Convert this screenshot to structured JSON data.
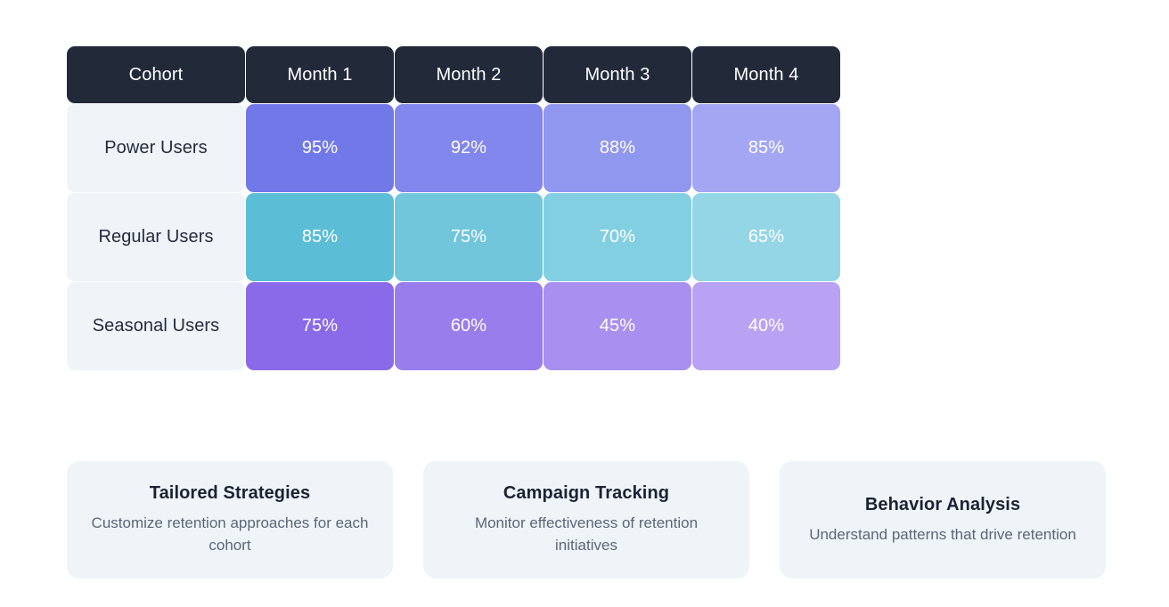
{
  "theme": {
    "page_background": "#ffffff",
    "header_cell_background": "#222a3a",
    "header_cell_text": "#ffffff",
    "label_cell_background": "#eff4f8",
    "label_cell_text": "#252b3d",
    "card_background": "#eff4f8",
    "card_title_color": "#1b2233",
    "card_desc_color": "#5a6678"
  },
  "matrix": {
    "columns": [
      "Cohort",
      "Month 1",
      "Month 2",
      "Month 3",
      "Month 4"
    ],
    "rows": [
      {
        "label": "Power Users",
        "cells": [
          {
            "value": "95%",
            "color": "#7179e8"
          },
          {
            "value": "92%",
            "color": "#8187ec"
          },
          {
            "value": "88%",
            "color": "#9097ef"
          },
          {
            "value": "85%",
            "color": "#a3a6f2"
          }
        ]
      },
      {
        "label": "Regular Users",
        "cells": [
          {
            "value": "85%",
            "color": "#5bbdd6"
          },
          {
            "value": "75%",
            "color": "#71c6dc"
          },
          {
            "value": "70%",
            "color": "#83cfe2"
          },
          {
            "value": "65%",
            "color": "#94d6e6"
          }
        ]
      },
      {
        "label": "Seasonal Users",
        "cells": [
          {
            "value": "75%",
            "color": "#8a6ae8"
          },
          {
            "value": "60%",
            "color": "#9a7dec"
          },
          {
            "value": "45%",
            "color": "#a98fef"
          },
          {
            "value": "40%",
            "color": "#b9a2f4"
          }
        ]
      }
    ]
  },
  "chart_data": {
    "type": "heatmap",
    "title": "",
    "xlabel": "",
    "ylabel": "Cohort",
    "x": [
      "Month 1",
      "Month 2",
      "Month 3",
      "Month 4"
    ],
    "y": [
      "Power Users",
      "Regular Users",
      "Seasonal Users"
    ],
    "unit": "%",
    "grid": false,
    "legend": "none",
    "series": [
      {
        "name": "Power Users",
        "values": [
          95,
          92,
          88,
          85
        ]
      },
      {
        "name": "Regular Users",
        "values": [
          85,
          75,
          70,
          65
        ]
      },
      {
        "name": "Seasonal Users",
        "values": [
          75,
          60,
          45,
          40
        ]
      }
    ],
    "value_labels": [
      [
        "95%",
        "92%",
        "88%",
        "85%"
      ],
      [
        "85%",
        "75%",
        "70%",
        "65%"
      ],
      [
        "75%",
        "60%",
        "45%",
        "40%"
      ]
    ],
    "cell_colors": [
      [
        "#7179e8",
        "#8187ec",
        "#9097ef",
        "#a3a6f2"
      ],
      [
        "#5bbdd6",
        "#71c6dc",
        "#83cfe2",
        "#94d6e6"
      ],
      [
        "#8a6ae8",
        "#9a7dec",
        "#a98fef",
        "#b9a2f4"
      ]
    ],
    "zlim": [
      40,
      95
    ]
  },
  "cards": [
    {
      "title": "Tailored Strategies",
      "description": "Customize retention approaches for each cohort"
    },
    {
      "title": "Campaign Tracking",
      "description": "Monitor effectiveness of retention initiatives"
    },
    {
      "title": "Behavior Analysis",
      "description": "Understand patterns that drive retention"
    }
  ]
}
